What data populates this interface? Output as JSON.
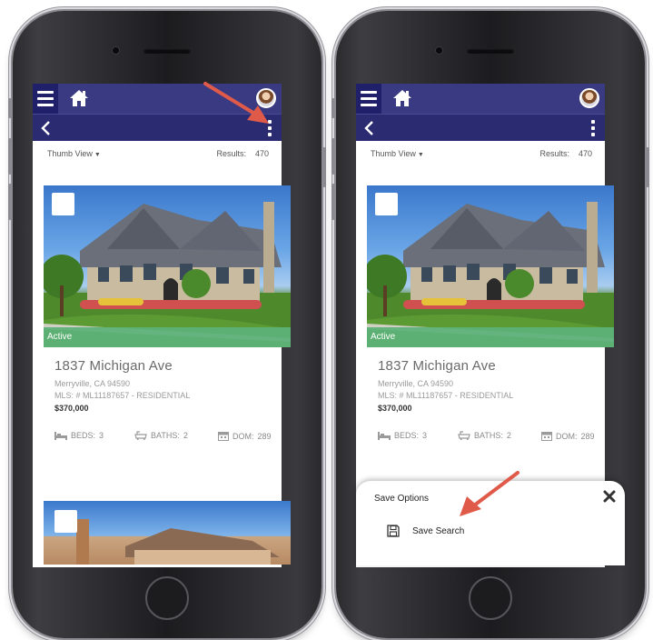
{
  "colors": {
    "topbar": "#3a3a82",
    "subbar": "#2b2b72",
    "status_active": "#5cb278",
    "arrow": "#e05a4a"
  },
  "icons": {
    "menu": "hamburger-icon",
    "home": "home-icon",
    "back": "chevron-left-icon",
    "more": "kebab-menu-icon",
    "beds": "bed-icon",
    "baths": "bathtub-icon",
    "dom": "calendar-icon",
    "close": "close-icon",
    "save": "floppy-disk-icon"
  },
  "screens": [
    {
      "thumb_view_label": "Thumb View",
      "results_label": "Results:",
      "results_count": "470",
      "listing": {
        "status": "Active",
        "address": "1837 Michigan Ave",
        "city": "Merryville, CA 94590",
        "mls": "MLS: # ML11187657 - RESIDENTIAL",
        "price": "$370,000",
        "beds_label": "BEDS:",
        "beds": "3",
        "baths_label": "BATHS:",
        "baths": "2",
        "dom_label": "DOM:",
        "dom": "289"
      }
    },
    {
      "thumb_view_label": "Thumb View",
      "results_label": "Results:",
      "results_count": "470",
      "listing": {
        "status": "Active",
        "address": "1837 Michigan Ave",
        "city": "Merryville, CA 94590",
        "mls": "MLS: # ML11187657 - RESIDENTIAL",
        "price": "$370,000",
        "beds_label": "BEDS:",
        "beds": "3",
        "baths_label": "BATHS:",
        "baths": "2",
        "dom_label": "DOM:",
        "dom": "289"
      },
      "sheet": {
        "title": "Save Options",
        "save_search_label": "Save Search"
      }
    }
  ]
}
